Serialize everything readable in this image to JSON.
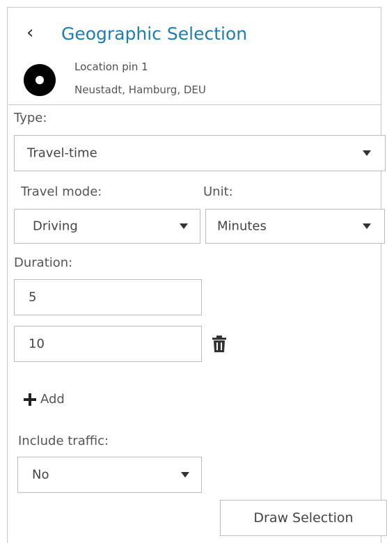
{
  "header": {
    "back_icon": "chevron-left-icon",
    "title": "Geographic Selection"
  },
  "location": {
    "icon": "location-pin-icon",
    "name": "Location pin 1",
    "address": "Neustadt, Hamburg, DEU"
  },
  "type": {
    "label": "Type:",
    "value": "Travel-time"
  },
  "travel_mode": {
    "label": "Travel mode:",
    "value": "Driving"
  },
  "unit": {
    "label": "Unit:",
    "value": "Minutes"
  },
  "duration": {
    "label": "Duration:",
    "values": [
      "5",
      "10"
    ],
    "delete_icon": "trash-icon",
    "add_label": "Add",
    "add_icon": "plus-icon"
  },
  "traffic": {
    "label": "Include traffic:",
    "value": "No"
  },
  "actions": {
    "draw_label": "Draw Selection"
  },
  "colors": {
    "title": "#1a7fb8",
    "border": "#bcbcbc"
  }
}
